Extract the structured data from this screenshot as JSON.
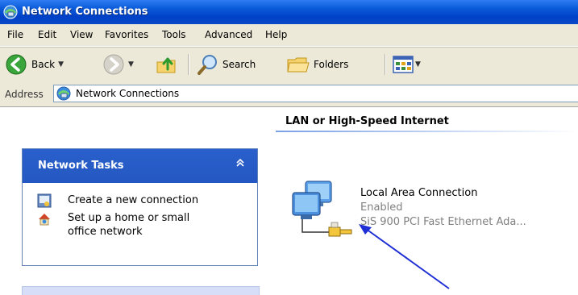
{
  "window": {
    "title": "Network Connections"
  },
  "menu": [
    "File",
    "Edit",
    "View",
    "Favorites",
    "Tools",
    "Advanced",
    "Help"
  ],
  "toolbar": {
    "back_label": "Back",
    "search_label": "Search",
    "folders_label": "Folders"
  },
  "address": {
    "label": "Address",
    "value": "Network Connections"
  },
  "tasks": {
    "title": "Network Tasks",
    "items": [
      {
        "label": "Create a new connection"
      },
      {
        "label_line1": "Set up a home or small",
        "label_line2": "office network"
      }
    ]
  },
  "main": {
    "section_title": "LAN or High-Speed Internet",
    "connection": {
      "name": "Local Area Connection",
      "status": "Enabled",
      "device": "SiS 900 PCI Fast Ethernet Ada..."
    }
  },
  "colors": {
    "title_bar": "#0a5bd9",
    "chrome": "#ece9d8",
    "task_header": "#2a60cc",
    "annotation_arrow": "#1f2fd6"
  }
}
